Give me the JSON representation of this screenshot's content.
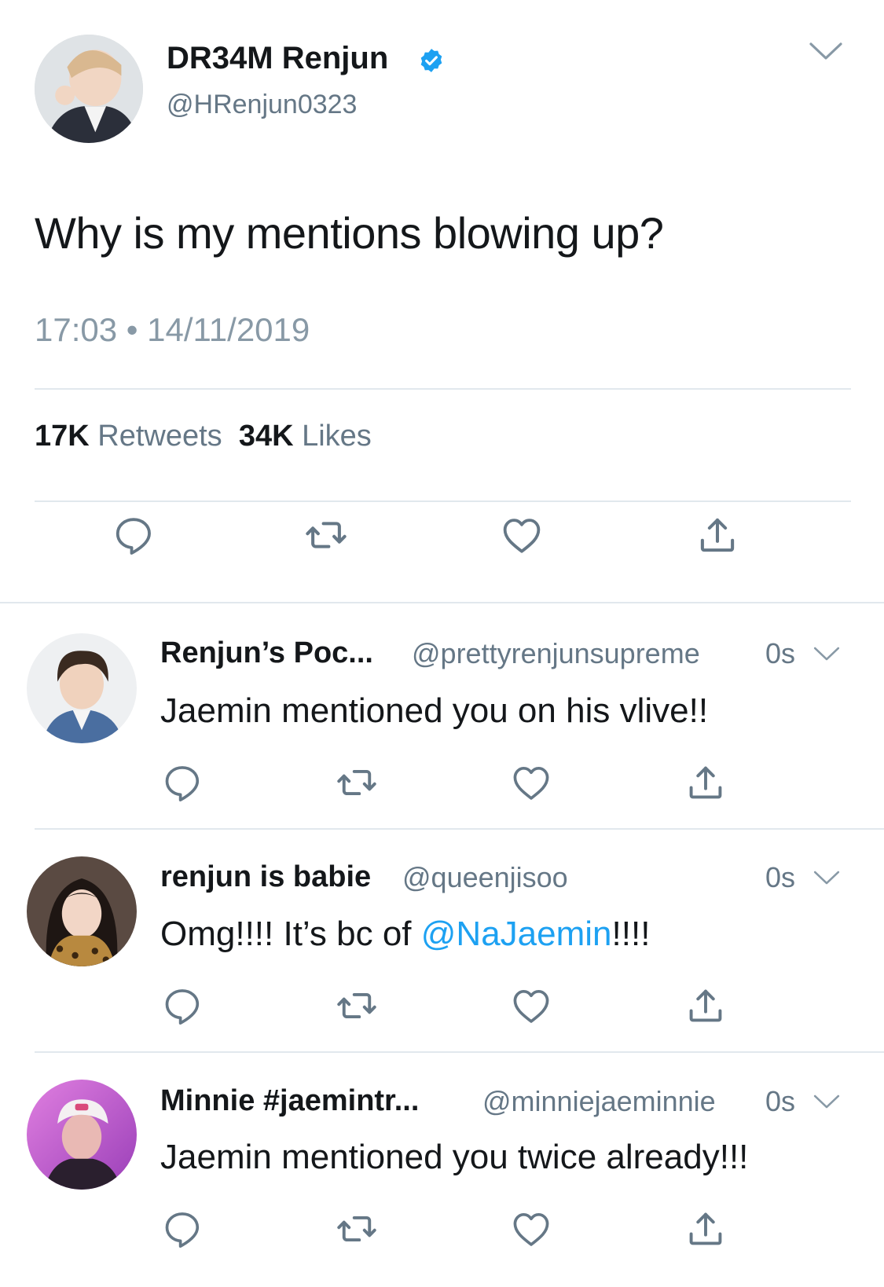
{
  "main_tweet": {
    "author_name": "DR34M Renjun",
    "author_handle": "@HRenjun0323",
    "verified_icon": "verified-badge-icon",
    "text": "Why is my mentions blowing up?",
    "time": "17:03",
    "separator": "•",
    "date": "14/11/2019",
    "retweets_count": "17K",
    "retweets_label": "Retweets",
    "likes_count": "34K",
    "likes_label": "Likes"
  },
  "action_icons": [
    "reply-icon",
    "retweet-icon",
    "like-icon",
    "share-icon"
  ],
  "replies": [
    {
      "name": "Renjun’s Poc...",
      "handle": "@prettyrenjunsupreme",
      "time": "0s",
      "text": "Jaemin mentioned you on his vlive!!"
    },
    {
      "name": "renjun is babie",
      "handle": "@queenjisoo",
      "time": "0s",
      "text_before": "Omg!!!! It’s bc of ",
      "mention": "@NaJaemin",
      "text_after": "!!!!"
    },
    {
      "name": "Minnie #jaemintr...",
      "handle": "@minniejaeminnie",
      "time": "0s",
      "text": "Jaemin mentioned you twice already!!!"
    }
  ],
  "colors": {
    "primary_text": "#14171a",
    "secondary_text": "#657786",
    "icon_gray": "#657786",
    "link_blue": "#1da1f2",
    "divider": "#e1e8ed"
  }
}
